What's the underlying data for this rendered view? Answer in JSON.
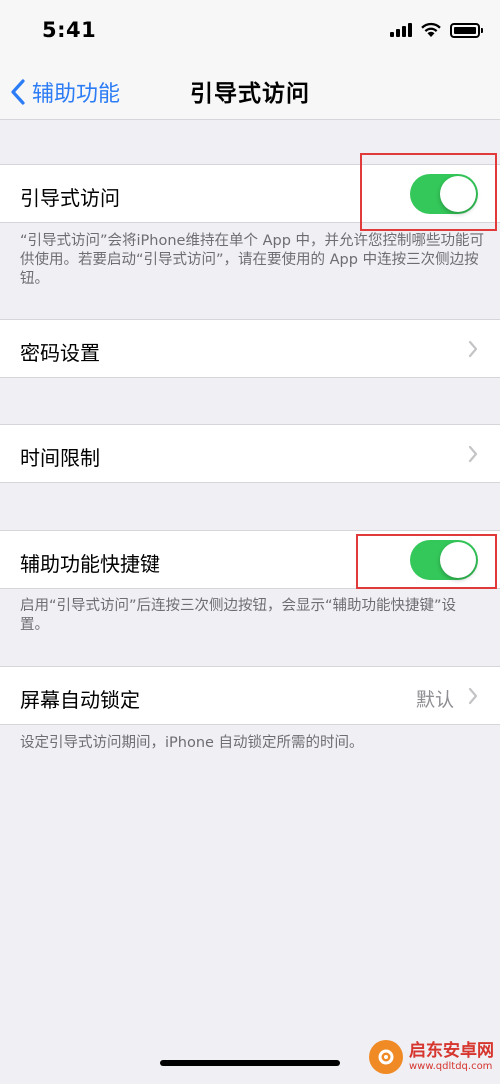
{
  "status_bar": {
    "time": "5:41",
    "icons": [
      "signal-icon",
      "wifi-icon",
      "battery-icon"
    ]
  },
  "nav": {
    "back_label": "辅助功能",
    "title": "引导式访问"
  },
  "cells": {
    "guided_access": {
      "label": "引导式访问",
      "toggle_on": true
    },
    "guided_access_footer": "“引导式访问”会将iPhone维持在单个 App 中，并允许您控制哪些功能可供使用。若要启动“引导式访问”，请在要使用的 App 中连按三次侧边按钮。",
    "passcode": {
      "label": "密码设置"
    },
    "time_limits": {
      "label": "时间限制"
    },
    "accessibility_shortcut": {
      "label": "辅助功能快捷键",
      "toggle_on": true
    },
    "shortcut_footer": "启用“引导式访问”后连按三次侧边按钮，会显示“辅助功能快捷键”设置。",
    "auto_lock": {
      "label": "屏幕自动锁定",
      "value": "默认"
    },
    "auto_lock_footer": "设定引导式访问期间，iPhone 自动锁定所需的时间。"
  },
  "watermark": {
    "name": "启东安卓网",
    "url": "www.qdltdq.com"
  },
  "colors": {
    "accent": "#2c7cf6",
    "toggle_on": "#34c759",
    "highlight": "#e03a3a",
    "background": "#efeff4"
  }
}
